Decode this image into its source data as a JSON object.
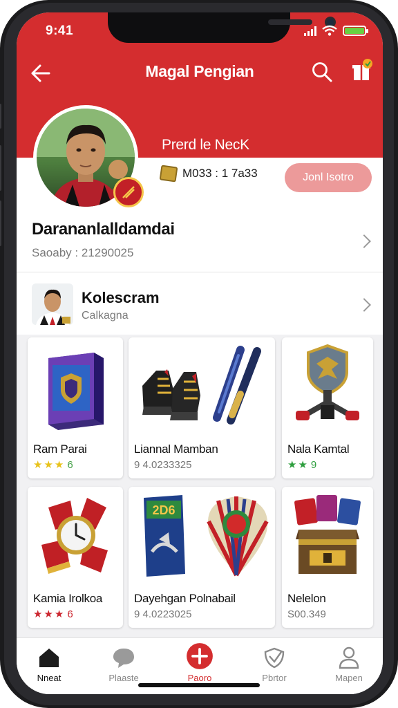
{
  "status_bar": {
    "time": "9:41"
  },
  "header": {
    "title": "Magal Pengian"
  },
  "profile": {
    "label": "Prerd le NecK",
    "stat_value": "M033 : 1 7a33",
    "join_button": "Jonl Isotro"
  },
  "user": {
    "name": "Darananlalldamdai",
    "subtitle": "Saoaby : 21290025"
  },
  "collection": {
    "title": "Kolescram",
    "subtitle": "Calkagna"
  },
  "items": [
    {
      "name": "Ram Parai",
      "stars": 3,
      "star_color": "#e8c21a",
      "meta": "6",
      "meta_color": "#43a047"
    },
    {
      "name": "Liannal Mamban",
      "stars": 0,
      "meta": "9 4.0233325"
    },
    {
      "name": "Nala Kamtal",
      "stars": 2,
      "star_color": "#2e9e3e",
      "meta": "9",
      "meta_color": "#2e9e3e"
    },
    {
      "name": "Kamia Irolkoa",
      "stars": 3,
      "star_color": "#cc2730",
      "meta": "6",
      "meta_color": "#cc2730"
    },
    {
      "name": "Dayehgan Polnabail",
      "stars": 0,
      "meta": "9 4.0223025"
    },
    {
      "name": "Nelelon",
      "stars": 0,
      "meta": "S00.349"
    }
  ],
  "tabs": [
    {
      "label": "Nneat",
      "icon": "home-icon",
      "active": false
    },
    {
      "label": "Plaaste",
      "icon": "chat-bubble-icon",
      "active": false
    },
    {
      "label": "Paoro",
      "icon": "plus-icon",
      "active": true
    },
    {
      "label": "Pbrtor",
      "icon": "heart-shield-icon",
      "active": false
    },
    {
      "label": "Mapen",
      "icon": "person-icon",
      "active": false
    }
  ],
  "colors": {
    "brand_red": "#d42d2f",
    "join_pink": "#ec9a9a"
  }
}
